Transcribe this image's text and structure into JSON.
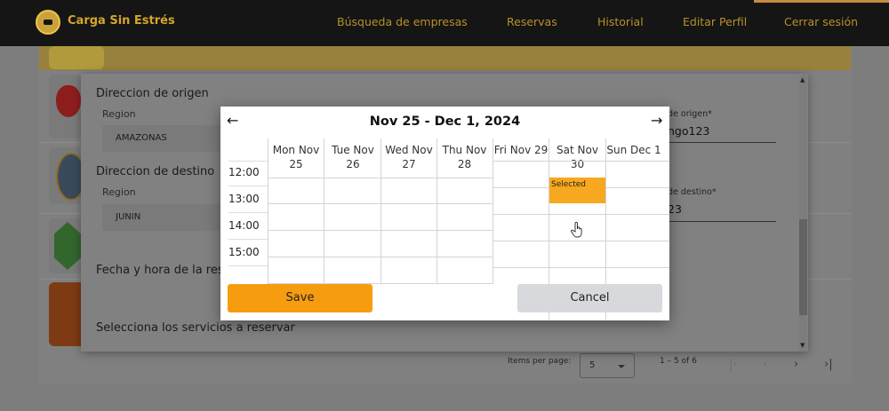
{
  "nav": {
    "brand": "Carga Sin Estrés",
    "links": [
      "Búsqueda de empresas",
      "Reservas",
      "Historial",
      "Editar Perfil",
      "Cerrar sesión"
    ]
  },
  "form": {
    "origin_section": "Direccion de origen",
    "origin_region_label": "Region",
    "origin_region_value": "AMAZONAS",
    "origin_address_label": "de origen*",
    "origin_address_value": "ngo123",
    "destination_section": "Direccion de destino",
    "destination_region_label": "Region",
    "destination_region_value": "JUNIN",
    "destination_address_label": "de destino*",
    "destination_address_value": "23",
    "datetime_section": "Fecha y hora de la res",
    "services_section": "Selecciona los servicios a reservar"
  },
  "paginator": {
    "items_per_page_label": "Items per page:",
    "items_per_page_value": "5",
    "range_label": "1 – 5 of 6"
  },
  "calendar": {
    "title": "Nov 25 - Dec 1, 2024",
    "prev_icon": "arrow-left-icon",
    "next_icon": "arrow-right-icon",
    "days": [
      {
        "line1": "Mon Nov",
        "line2": "25"
      },
      {
        "line1": "Tue Nov",
        "line2": "26"
      },
      {
        "line1": "Wed Nov",
        "line2": "27"
      },
      {
        "line1": "Thu Nov",
        "line2": "28"
      },
      {
        "line1": "Fri Nov 29",
        "line2": ""
      },
      {
        "line1": "Sat Nov",
        "line2": "30"
      },
      {
        "line1": "Sun Dec 1",
        "line2": ""
      }
    ],
    "times": [
      "12:00",
      "13:00",
      "14:00",
      "15:00"
    ],
    "selected_label": "Selected",
    "save_label": "Save",
    "cancel_label": "Cancel"
  },
  "colors": {
    "accent": "#f59d0f",
    "brand_gold": "#d6a62a",
    "nav_bg": "#151515"
  }
}
